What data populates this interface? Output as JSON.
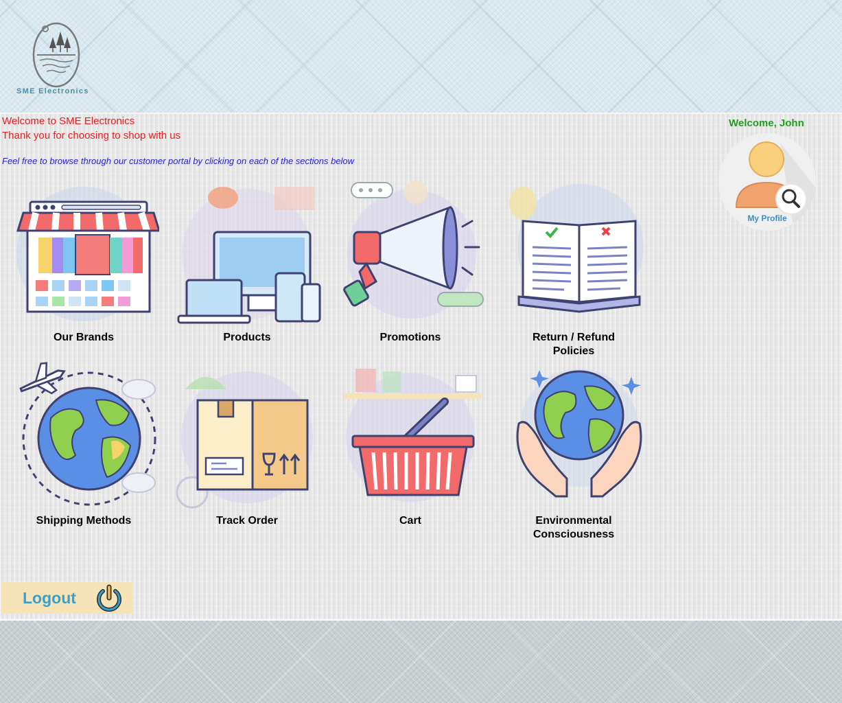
{
  "brand": {
    "name": "SME Electronics"
  },
  "intro": {
    "welcome": "Welcome to SME Electronics",
    "thanks": "Thank you for choosing to shop with us",
    "browse": "Feel free to browse through our customer portal by clicking on each of the sections below"
  },
  "user": {
    "greeting": "Welcome, John",
    "profile_label": "My Profile"
  },
  "tiles": [
    {
      "label": "Our Brands",
      "icon": "storefront-icon"
    },
    {
      "label": "Products",
      "icon": "devices-icon"
    },
    {
      "label": "Promotions",
      "icon": "megaphone-icon"
    },
    {
      "label": "Return / Refund\nPolicies",
      "icon": "policy-book-icon"
    },
    {
      "label": "Shipping Methods",
      "icon": "globe-airplane-icon"
    },
    {
      "label": "Track Order",
      "icon": "package-box-icon"
    },
    {
      "label": "Cart",
      "icon": "shopping-basket-icon"
    },
    {
      "label": "Environmental\nConsciousness",
      "icon": "hands-globe-icon"
    }
  ],
  "logout": {
    "label": "Logout",
    "icon": "power-icon"
  },
  "colors": {
    "welcome_red": "#ee1c1c",
    "browse_blue": "#2323d6",
    "greeting_green": "#1ea01e",
    "logout_bg": "#f6e3b7",
    "logout_text": "#3a9fc9"
  }
}
